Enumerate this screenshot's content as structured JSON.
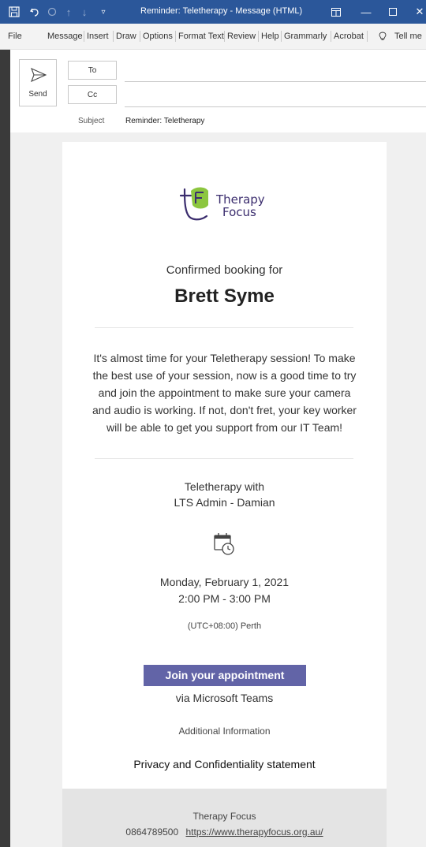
{
  "window": {
    "title": "Reminder: Teletherapy - Message (HTML)",
    "tell_me": "Tell me",
    "icons": [
      "save-icon",
      "undo-icon",
      "redo-icon",
      "up-icon",
      "down-icon",
      "customize-icon",
      "restore-layout-icon",
      "minimize-icon",
      "maximize-icon",
      "close-icon"
    ]
  },
  "ribbon": {
    "tabs": [
      "File",
      "Message",
      "Insert",
      "Draw",
      "Options",
      "Format Text",
      "Review",
      "Help",
      "Grammarly",
      "Acrobat"
    ]
  },
  "compose": {
    "send_label": "Send",
    "to_label": "To",
    "cc_label": "Cc",
    "subject_label": "Subject",
    "subject_value": "Reminder: Teletherapy"
  },
  "email": {
    "logo_line1": "Therapy",
    "logo_line2": "Focus",
    "confirmed": "Confirmed booking for",
    "client_name": "Brett Syme",
    "paragraph": "It's almost time for your Teletherapy session! To make the best use of your session, now is a good time to try and join the appointment to make sure your camera and audio is working. If not, don't fret, your key worker will be able to get you support from our IT Team!",
    "teletherapy_with": "Teletherapy with",
    "worker": "LTS Admin - Damian",
    "date": "Monday, February 1, 2021",
    "time": "2:00 PM - 3:00 PM",
    "timezone": "(UTC+08:00) Perth",
    "join_button": "Join your appointment",
    "via": "via Microsoft Teams",
    "additional_info": "Additional Information",
    "privacy": "Privacy and Confidentiality statement",
    "footer_org": "Therapy Focus",
    "footer_phone": "0864789500",
    "footer_url": "https://www.therapyfocus.org.au/"
  },
  "colors": {
    "titlebar": "#2b579a",
    "teams_button": "#6264a7",
    "logo_green": "#8cc63f",
    "logo_purple": "#3b2d6e"
  }
}
